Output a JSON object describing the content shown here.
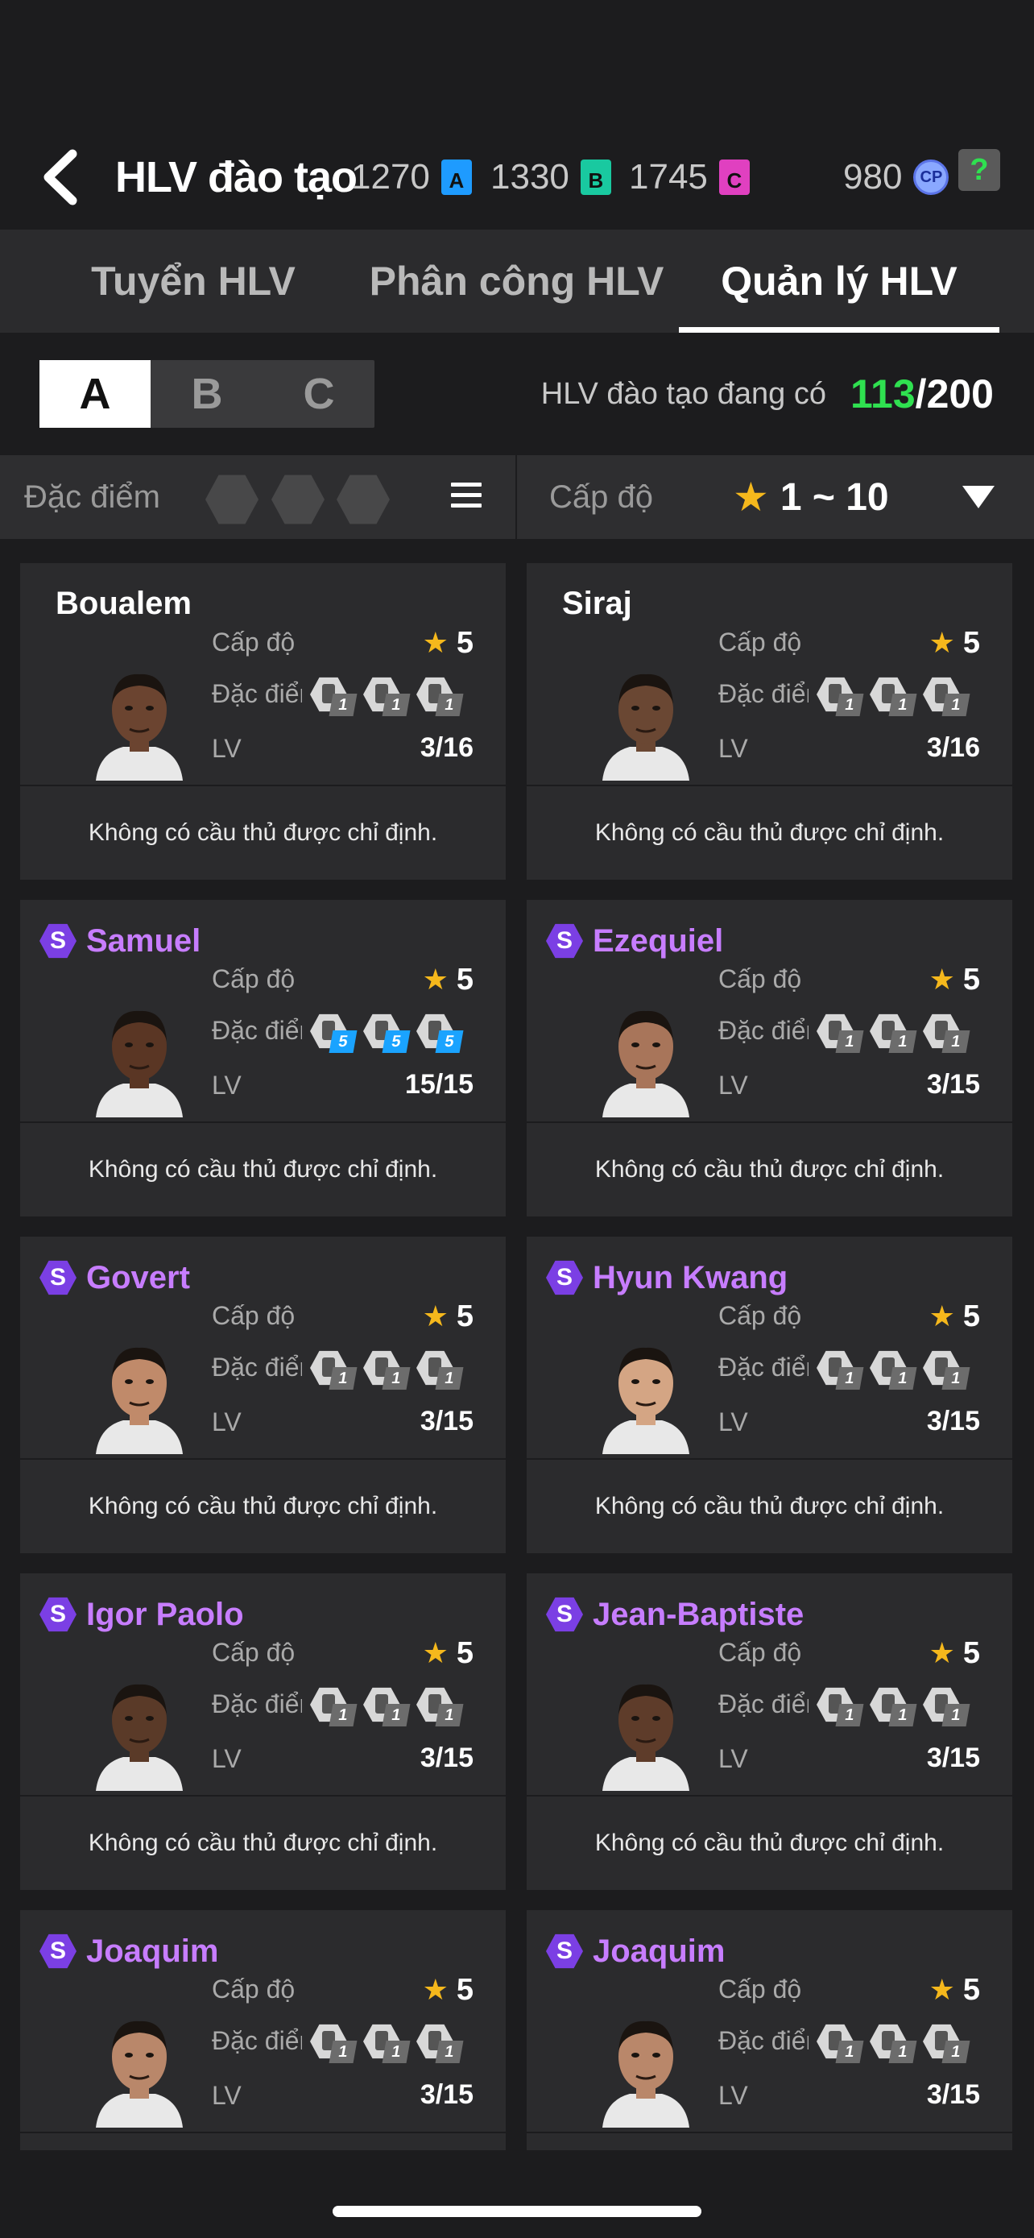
{
  "header": {
    "title": "HLV đào tạo",
    "currencies": [
      {
        "value": "1270",
        "badge": "A",
        "color": "#1e9bff"
      },
      {
        "value": "1330",
        "badge": "B",
        "color": "#19c9a0"
      },
      {
        "value": "1745",
        "badge": "C",
        "color": "#e040c0"
      },
      {
        "value": "980",
        "badge": "CP",
        "color": "#8aa8ff"
      }
    ],
    "help": "?"
  },
  "tabs": [
    {
      "label": "Tuyển HLV",
      "active": false
    },
    {
      "label": "Phân công HLV",
      "active": false
    },
    {
      "label": "Quản lý HLV",
      "active": true
    }
  ],
  "grades": [
    "A",
    "B",
    "C"
  ],
  "active_grade": "A",
  "count": {
    "label": "HLV đào tạo đang có",
    "current": "113",
    "total": "/200"
  },
  "filter": {
    "trait_label": "Đặc điểm c",
    "level_label": "Cấp độ",
    "level_range": "1 ~ 10"
  },
  "card_labels": {
    "grade": "Cấp độ",
    "trait": "Đặc điểm",
    "lv": "LV",
    "footer": "Không có cầu thủ được chỉ định."
  },
  "coaches": [
    {
      "name": "Boualem",
      "special": false,
      "grade": "5",
      "lv": "3/16",
      "traits": [
        "1",
        "1",
        "1"
      ],
      "blue": false,
      "skin": "#6b4430"
    },
    {
      "name": "Siraj",
      "special": false,
      "grade": "5",
      "lv": "3/16",
      "traits": [
        "1",
        "1",
        "1"
      ],
      "blue": false,
      "skin": "#6a4733"
    },
    {
      "name": "Samuel",
      "special": true,
      "grade": "5",
      "lv": "15/15",
      "traits": [
        "5",
        "5",
        "5"
      ],
      "blue": true,
      "skin": "#5a3624"
    },
    {
      "name": "Ezequiel",
      "special": true,
      "grade": "5",
      "lv": "3/15",
      "traits": [
        "1",
        "1",
        "1"
      ],
      "blue": false,
      "skin": "#a8755a"
    },
    {
      "name": "Govert",
      "special": true,
      "grade": "5",
      "lv": "3/15",
      "traits": [
        "1",
        "1",
        "1"
      ],
      "blue": false,
      "skin": "#c08a6a"
    },
    {
      "name": "Hyun Kwang",
      "special": true,
      "grade": "5",
      "lv": "3/15",
      "traits": [
        "1",
        "1",
        "1"
      ],
      "blue": false,
      "skin": "#d4a584"
    },
    {
      "name": "Igor Paolo",
      "special": true,
      "grade": "5",
      "lv": "3/15",
      "traits": [
        "1",
        "1",
        "1"
      ],
      "blue": false,
      "skin": "#5a3a28"
    },
    {
      "name": "Jean-Baptiste",
      "special": true,
      "grade": "5",
      "lv": "3/15",
      "traits": [
        "1",
        "1",
        "1"
      ],
      "blue": false,
      "skin": "#5e3c2a"
    },
    {
      "name": "Joaquim",
      "special": true,
      "grade": "5",
      "lv": "3/15",
      "traits": [
        "1",
        "1",
        "1"
      ],
      "blue": false,
      "skin": "#b9876a"
    },
    {
      "name": "Joaquim",
      "special": true,
      "grade": "5",
      "lv": "3/15",
      "traits": [
        "1",
        "1",
        "1"
      ],
      "blue": false,
      "skin": "#b9876a"
    }
  ]
}
